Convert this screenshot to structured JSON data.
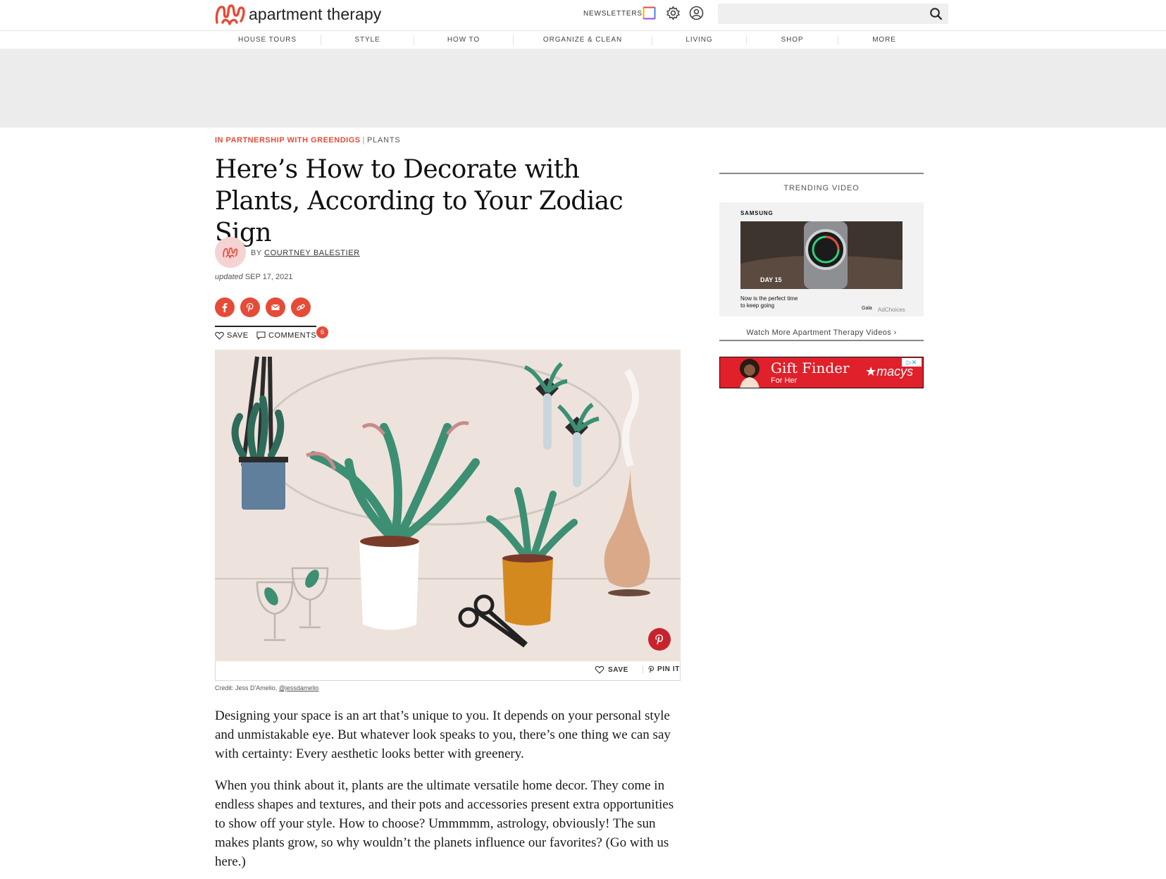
{
  "header": {
    "logo_text": "apartment therapy",
    "newsletters_label": "NEWSLETTERS",
    "search_placeholder": ""
  },
  "nav": {
    "items": [
      "HOUSE TOURS",
      "STYLE",
      "HOW TO",
      "ORGANIZE & CLEAN",
      "LIVING",
      "SHOP",
      "MORE"
    ]
  },
  "article": {
    "partner_label": "IN PARTNERSHIP WITH GREENDIGS",
    "separator": "|",
    "category": "PLANTS",
    "headline": "Here’s How to Decorate with Plants, According to Your Zodiac Sign",
    "by_label": "BY",
    "author": "COURTNEY BALESTIER",
    "updated_label": "updated",
    "updated_date": "SEP 17, 2021",
    "save_label": "SAVE",
    "comments_label": "COMMENTS",
    "comments_count": "6",
    "image_save_label": "SAVE",
    "image_pin_label": "PIN IT",
    "credit_prefix": "Credit: Jess D'Amelio,",
    "credit_handle": "@jessdamelio",
    "paragraphs": [
      "Designing your space is an art that’s unique to you. It depends on your personal style and unmistakable eye. But whatever look speaks to you, there’s one thing we can say with certainty: Every aesthetic looks better with greenery.",
      "When you think about it, plants are the ultimate versatile home decor. They come in endless shapes and textures, and their pots and accessories present extra opportunities to show off your style. How to choose? Ummmmm, astrology, obviously! The sun makes plants grow, so why wouldn’t the planets influence our favorites? (Go with us here.)"
    ]
  },
  "sidebar": {
    "trending_label": "TRENDING VIDEO",
    "video_brand": "SAMSUNG",
    "video_day": "DAY 15",
    "video_caption_line1": "Now is the perfect time",
    "video_caption_line2": "to keep going",
    "video_gala": "Gala",
    "video_adchoices": "AdChoices",
    "watch_more": "Watch More Apartment Therapy Videos ›",
    "ad_title": "Gift Finder",
    "ad_subtitle": "For Her",
    "ad_brand": "★macys"
  },
  "colors": {
    "accent": "#e64b37",
    "pinterest": "#c8232c",
    "macys_red": "#e0202a"
  },
  "icons": {
    "share": [
      "facebook-icon",
      "pinterest-icon",
      "email-icon",
      "link-icon"
    ]
  }
}
